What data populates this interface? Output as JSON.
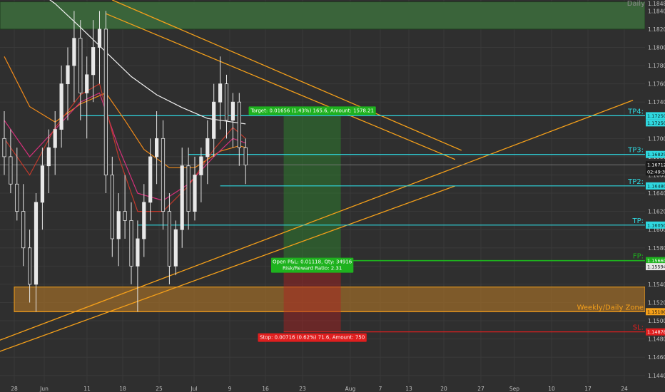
{
  "timeframe": "Daily",
  "colors": {
    "background": "#2f2f2f",
    "grid": "#3a3a3a",
    "candle": "#e8e8e8",
    "cyan": "#2fd8e0",
    "orange": "#f5a01a",
    "green_zone": "#3c6a3c",
    "weekly_zone": "#9a6a2a",
    "ema_white": "#f2f2f2",
    "ema_orange": "#f08a1a",
    "ema_pink": "#d4307a",
    "ema_red": "#c0392b",
    "entry_green": "#1eb21e",
    "stop_red": "#e01e1e"
  },
  "chart_data": {
    "type": "candlestick",
    "x_ticks": [
      "28",
      "Jun",
      "11",
      "18",
      "25",
      "Jul",
      "9",
      "16",
      "23",
      "Aug",
      "7",
      "13",
      "20",
      "27",
      "Sep",
      "10",
      "17",
      "24"
    ],
    "y_ticks": [
      "1.18480",
      "1.18400",
      "1.18200",
      "1.18000",
      "1.17800",
      "1.17600",
      "1.17400",
      "1.17000",
      "1.16800",
      "1.16600",
      "1.16400",
      "1.16200",
      "1.16000",
      "1.15800",
      "1.15600",
      "1.15400",
      "1.15200",
      "1.15000",
      "1.14800",
      "1.14600",
      "1.14400"
    ],
    "ylim": [
      1.1432,
      1.1852
    ],
    "current_price": "1.16712",
    "countdown": "02:49:30",
    "candles": [
      {
        "t": 0,
        "o": 1.17,
        "h": 1.173,
        "l": 1.166,
        "c": 1.168
      },
      {
        "t": 1,
        "o": 1.168,
        "h": 1.171,
        "l": 1.164,
        "c": 1.165
      },
      {
        "t": 2,
        "o": 1.165,
        "h": 1.169,
        "l": 1.161,
        "c": 1.162
      },
      {
        "t": 3,
        "o": 1.162,
        "h": 1.165,
        "l": 1.156,
        "c": 1.158
      },
      {
        "t": 4,
        "o": 1.158,
        "h": 1.16,
        "l": 1.152,
        "c": 1.154
      },
      {
        "t": 5,
        "o": 1.154,
        "h": 1.164,
        "l": 1.151,
        "c": 1.163
      },
      {
        "t": 6,
        "o": 1.163,
        "h": 1.169,
        "l": 1.16,
        "c": 1.167
      },
      {
        "t": 7,
        "o": 1.167,
        "h": 1.171,
        "l": 1.164,
        "c": 1.169
      },
      {
        "t": 8,
        "o": 1.169,
        "h": 1.173,
        "l": 1.166,
        "c": 1.171
      },
      {
        "t": 9,
        "o": 1.171,
        "h": 1.178,
        "l": 1.169,
        "c": 1.176
      },
      {
        "t": 10,
        "o": 1.176,
        "h": 1.18,
        "l": 1.172,
        "c": 1.178
      },
      {
        "t": 11,
        "o": 1.178,
        "h": 1.184,
        "l": 1.174,
        "c": 1.181
      },
      {
        "t": 12,
        "o": 1.181,
        "h": 1.183,
        "l": 1.172,
        "c": 1.175
      },
      {
        "t": 13,
        "o": 1.175,
        "h": 1.179,
        "l": 1.17,
        "c": 1.177
      },
      {
        "t": 14,
        "o": 1.177,
        "h": 1.183,
        "l": 1.174,
        "c": 1.18
      },
      {
        "t": 15,
        "o": 1.18,
        "h": 1.184,
        "l": 1.176,
        "c": 1.182
      },
      {
        "t": 16,
        "o": 1.182,
        "h": 1.184,
        "l": 1.164,
        "c": 1.166
      },
      {
        "t": 17,
        "o": 1.166,
        "h": 1.168,
        "l": 1.157,
        "c": 1.159
      },
      {
        "t": 18,
        "o": 1.159,
        "h": 1.164,
        "l": 1.156,
        "c": 1.162
      },
      {
        "t": 19,
        "o": 1.162,
        "h": 1.166,
        "l": 1.159,
        "c": 1.161
      },
      {
        "t": 20,
        "o": 1.161,
        "h": 1.163,
        "l": 1.154,
        "c": 1.156
      },
      {
        "t": 21,
        "o": 1.156,
        "h": 1.161,
        "l": 1.151,
        "c": 1.159
      },
      {
        "t": 22,
        "o": 1.159,
        "h": 1.165,
        "l": 1.157,
        "c": 1.163
      },
      {
        "t": 23,
        "o": 1.163,
        "h": 1.17,
        "l": 1.161,
        "c": 1.168
      },
      {
        "t": 24,
        "o": 1.168,
        "h": 1.173,
        "l": 1.165,
        "c": 1.17
      },
      {
        "t": 25,
        "o": 1.17,
        "h": 1.172,
        "l": 1.16,
        "c": 1.162
      },
      {
        "t": 26,
        "o": 1.162,
        "h": 1.164,
        "l": 1.154,
        "c": 1.156
      },
      {
        "t": 27,
        "o": 1.156,
        "h": 1.161,
        "l": 1.155,
        "c": 1.16
      },
      {
        "t": 28,
        "o": 1.16,
        "h": 1.169,
        "l": 1.158,
        "c": 1.167
      },
      {
        "t": 29,
        "o": 1.167,
        "h": 1.169,
        "l": 1.16,
        "c": 1.162
      },
      {
        "t": 30,
        "o": 1.162,
        "h": 1.168,
        "l": 1.161,
        "c": 1.166
      },
      {
        "t": 31,
        "o": 1.166,
        "h": 1.169,
        "l": 1.163,
        "c": 1.168
      },
      {
        "t": 32,
        "o": 1.168,
        "h": 1.172,
        "l": 1.165,
        "c": 1.17
      },
      {
        "t": 33,
        "o": 1.17,
        "h": 1.176,
        "l": 1.168,
        "c": 1.174
      },
      {
        "t": 34,
        "o": 1.174,
        "h": 1.179,
        "l": 1.171,
        "c": 1.176
      },
      {
        "t": 35,
        "o": 1.176,
        "h": 1.177,
        "l": 1.17,
        "c": 1.172
      },
      {
        "t": 36,
        "o": 1.172,
        "h": 1.175,
        "l": 1.169,
        "c": 1.174
      },
      {
        "t": 37,
        "o": 1.174,
        "h": 1.175,
        "l": 1.167,
        "c": 1.169
      },
      {
        "t": 38,
        "o": 1.169,
        "h": 1.17,
        "l": 1.165,
        "c": 1.1671
      }
    ],
    "moving_averages": [
      {
        "key": "ema_white",
        "points": [
          [
            0,
            1.189
          ],
          [
            4,
            1.1868
          ],
          [
            8,
            1.1848
          ],
          [
            12,
            1.1822
          ],
          [
            16,
            1.1795
          ],
          [
            20,
            1.1768
          ],
          [
            24,
            1.1748
          ],
          [
            28,
            1.1734
          ],
          [
            32,
            1.1722
          ],
          [
            36,
            1.1718
          ],
          [
            38,
            1.1716
          ]
        ]
      },
      {
        "key": "ema_orange",
        "points": [
          [
            0,
            1.179
          ],
          [
            4,
            1.1735
          ],
          [
            8,
            1.1718
          ],
          [
            12,
            1.1738
          ],
          [
            16,
            1.175
          ],
          [
            19,
            1.172
          ],
          [
            22,
            1.1688
          ],
          [
            26,
            1.1668
          ],
          [
            30,
            1.1668
          ],
          [
            34,
            1.1686
          ],
          [
            37,
            1.1692
          ],
          [
            38,
            1.169
          ]
        ]
      },
      {
        "key": "ema_pink",
        "points": [
          [
            0,
            1.172
          ],
          [
            4,
            1.168
          ],
          [
            8,
            1.171
          ],
          [
            12,
            1.174
          ],
          [
            15,
            1.175
          ],
          [
            18,
            1.169
          ],
          [
            21,
            1.164
          ],
          [
            25,
            1.1632
          ],
          [
            29,
            1.165
          ],
          [
            33,
            1.168
          ],
          [
            36,
            1.17
          ],
          [
            38,
            1.1695
          ]
        ]
      },
      {
        "key": "ema_red",
        "points": [
          [
            0,
            1.17
          ],
          [
            4,
            1.166
          ],
          [
            8,
            1.1712
          ],
          [
            12,
            1.1748
          ],
          [
            15,
            1.176
          ],
          [
            18,
            1.168
          ],
          [
            21,
            1.162
          ],
          [
            25,
            1.162
          ],
          [
            29,
            1.1648
          ],
          [
            33,
            1.1688
          ],
          [
            36,
            1.1712
          ],
          [
            38,
            1.17
          ]
        ]
      }
    ],
    "zones": [
      {
        "key": "green_zone",
        "from": 1.185,
        "to": 1.182
      },
      {
        "key": "weekly_zone",
        "from": 1.1537,
        "to": 1.151
      }
    ],
    "levels": [
      {
        "name": "TP4",
        "label": "TP4:",
        "price": 1.1725,
        "tag": "1.17250",
        "start": 12,
        "color_key": "cyan"
      },
      {
        "name": "TP3",
        "label": "TP3:",
        "price": 1.16825,
        "tag": "1.16825",
        "start": 29,
        "color_key": "cyan"
      },
      {
        "name": "TP2",
        "label": "TP2:",
        "price": 1.1648,
        "tag": "1.16480",
        "start": 34,
        "color_key": "cyan"
      },
      {
        "name": "TP1",
        "label": "TP:",
        "price": 1.1605,
        "tag": "1.16050",
        "start": 21,
        "color_key": "cyan"
      },
      {
        "name": "FP",
        "label": "FP:",
        "price": 1.1566,
        "tag": "1.15660",
        "start": 44,
        "color_key": "entry_green"
      },
      {
        "name": "SL",
        "label": "SL:",
        "price": 1.14878,
        "tag": "1.14878",
        "start": 44,
        "color_key": "stop_red"
      }
    ],
    "extra_price_tags": [
      {
        "name": "price-tag-1.15594",
        "text": "1.15594",
        "price": 1.15594
      },
      {
        "name": "price-tag-1.15100",
        "text": "1.15100",
        "price": 1.151,
        "color_key": "orange"
      },
      {
        "name": "price-tag-1.17250-dup",
        "text": "1.17250",
        "price": 1.1725,
        "offset": 10,
        "color_key": "cyan"
      }
    ],
    "zone_label": "Weekly/Daily Zone",
    "trend_lines": [
      {
        "p1": [
          17,
          1.1852
        ],
        "p2": [
          72,
          1.1687
        ]
      },
      {
        "p1": [
          16,
          1.1837
        ],
        "p2": [
          71,
          1.1677
        ]
      },
      {
        "p1": [
          -4,
          1.147
        ],
        "p2": [
          99,
          1.1742
        ]
      },
      {
        "p1": [
          -4,
          1.1458
        ],
        "p2": [
          71,
          1.1648
        ]
      }
    ],
    "trade": {
      "entry": 1.1566,
      "target": 1.1725,
      "stop": 1.14878,
      "t_start": 44,
      "t_end": 53,
      "target_label": "Target: 0.01656 (1.43%) 165.6, Amount: 1578.21",
      "open_pnl_label": "Open P&L: 0.01118, Qty: 34916",
      "rr_label": "Risk/Reward Ratio: 2.31",
      "stop_label": "Stop: 0.00716 (0.62%) 71.6, Amount: 750"
    }
  }
}
